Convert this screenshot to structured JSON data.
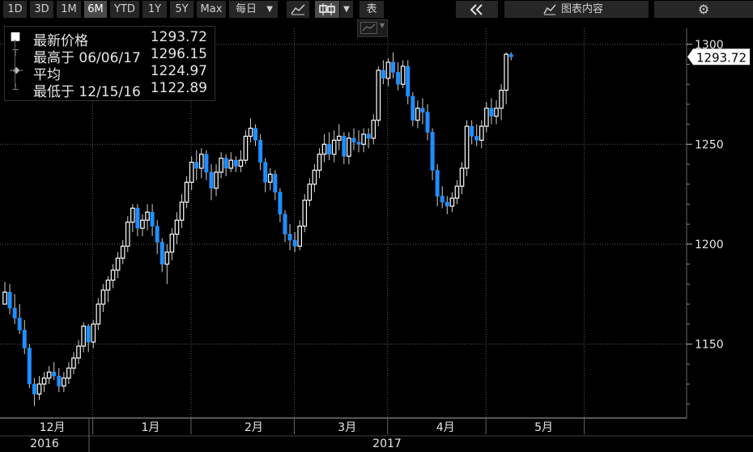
{
  "toolbar": {
    "periods": [
      {
        "label": "1D",
        "active": false
      },
      {
        "label": "3D",
        "active": false
      },
      {
        "label": "1M",
        "active": false
      },
      {
        "label": "6M",
        "active": true
      },
      {
        "label": "YTD",
        "active": false
      },
      {
        "label": "1Y",
        "active": false
      },
      {
        "label": "5Y",
        "active": false
      },
      {
        "label": "Max",
        "active": false
      }
    ],
    "frequency": "每日",
    "table_label": "表",
    "panel_label": "图表内容"
  },
  "legend": {
    "rows": [
      {
        "label": "最新价格",
        "value": "1293.72",
        "mark": "■"
      },
      {
        "label": "最高于 06/06/17",
        "value": "1296.15",
        "mark": "⊤"
      },
      {
        "label": "平均",
        "value": "1224.97",
        "mark": "-◆-"
      },
      {
        "label": "最低于 12/15/16",
        "value": "1122.89",
        "mark": "⊥"
      }
    ]
  },
  "chart_data": {
    "type": "candlestick",
    "ylim": [
      1113,
      1308
    ],
    "y_ticks": [
      1150,
      1200,
      1250,
      1300
    ],
    "grid": true,
    "last_price_label": "1293.72",
    "up_color": "#ffffff",
    "down_color": "#1f8fff",
    "month_labels": [
      {
        "label": "12月",
        "index": 8
      },
      {
        "label": "1月",
        "index": 28
      },
      {
        "label": "2月",
        "index": 49
      },
      {
        "label": "3月",
        "index": 68
      },
      {
        "label": "4月",
        "index": 88
      },
      {
        "label": "5月",
        "index": 108
      }
    ],
    "year_labels": [
      {
        "label": "2016",
        "index": 8
      },
      {
        "label": "2017",
        "index": 70
      }
    ],
    "candles": [
      [
        1170,
        1181,
        1170,
        1176
      ],
      [
        1176,
        1180,
        1165,
        1168
      ],
      [
        1168,
        1175,
        1160,
        1163
      ],
      [
        1163,
        1170,
        1155,
        1157
      ],
      [
        1157,
        1162,
        1145,
        1148
      ],
      [
        1148,
        1150,
        1128,
        1130
      ],
      [
        1130,
        1133,
        1119,
        1125
      ],
      [
        1125,
        1134,
        1122,
        1130
      ],
      [
        1130,
        1136,
        1126,
        1133
      ],
      [
        1133,
        1139,
        1130,
        1136
      ],
      [
        1136,
        1141,
        1132,
        1134
      ],
      [
        1134,
        1138,
        1126,
        1129
      ],
      [
        1129,
        1136,
        1126,
        1133
      ],
      [
        1133,
        1141,
        1130,
        1138
      ],
      [
        1138,
        1146,
        1135,
        1143
      ],
      [
        1143,
        1152,
        1140,
        1149
      ],
      [
        1149,
        1161,
        1146,
        1159
      ],
      [
        1159,
        1160,
        1146,
        1151
      ],
      [
        1151,
        1162,
        1148,
        1160
      ],
      [
        1160,
        1173,
        1157,
        1170
      ],
      [
        1170,
        1180,
        1166,
        1177
      ],
      [
        1177,
        1184,
        1171,
        1182
      ],
      [
        1182,
        1190,
        1178,
        1187
      ],
      [
        1187,
        1196,
        1183,
        1193
      ],
      [
        1193,
        1202,
        1190,
        1199
      ],
      [
        1199,
        1214,
        1196,
        1211
      ],
      [
        1211,
        1220,
        1206,
        1218
      ],
      [
        1218,
        1220,
        1204,
        1208
      ],
      [
        1208,
        1215,
        1204,
        1212
      ],
      [
        1212,
        1220,
        1207,
        1216
      ],
      [
        1216,
        1220,
        1204,
        1209
      ],
      [
        1209,
        1212,
        1195,
        1201
      ],
      [
        1201,
        1203,
        1186,
        1190
      ],
      [
        1190,
        1200,
        1180,
        1196
      ],
      [
        1196,
        1208,
        1192,
        1205
      ],
      [
        1205,
        1216,
        1200,
        1212
      ],
      [
        1212,
        1225,
        1208,
        1221
      ],
      [
        1221,
        1234,
        1218,
        1231
      ],
      [
        1231,
        1244,
        1227,
        1241
      ],
      [
        1241,
        1247,
        1232,
        1238
      ],
      [
        1238,
        1248,
        1233,
        1245
      ],
      [
        1245,
        1247,
        1232,
        1236
      ],
      [
        1236,
        1240,
        1222,
        1228
      ],
      [
        1228,
        1240,
        1224,
        1236
      ],
      [
        1236,
        1246,
        1233,
        1243
      ],
      [
        1243,
        1245,
        1234,
        1238
      ],
      [
        1238,
        1246,
        1236,
        1242
      ],
      [
        1242,
        1244,
        1236,
        1239
      ],
      [
        1239,
        1247,
        1236,
        1242
      ],
      [
        1242,
        1257,
        1240,
        1254
      ],
      [
        1254,
        1263,
        1251,
        1258
      ],
      [
        1258,
        1260,
        1249,
        1252
      ],
      [
        1252,
        1255,
        1237,
        1241
      ],
      [
        1241,
        1243,
        1226,
        1231
      ],
      [
        1231,
        1238,
        1227,
        1235
      ],
      [
        1235,
        1237,
        1222,
        1226
      ],
      [
        1226,
        1228,
        1211,
        1215
      ],
      [
        1215,
        1217,
        1201,
        1205
      ],
      [
        1205,
        1210,
        1197,
        1202
      ],
      [
        1202,
        1206,
        1196,
        1199
      ],
      [
        1199,
        1212,
        1197,
        1209
      ],
      [
        1209,
        1225,
        1206,
        1222
      ],
      [
        1222,
        1233,
        1219,
        1230
      ],
      [
        1230,
        1240,
        1226,
        1237
      ],
      [
        1237,
        1248,
        1233,
        1245
      ],
      [
        1245,
        1255,
        1241,
        1250
      ],
      [
        1250,
        1256,
        1242,
        1245
      ],
      [
        1245,
        1257,
        1241,
        1252
      ],
      [
        1252,
        1260,
        1247,
        1254
      ],
      [
        1254,
        1256,
        1240,
        1244
      ],
      [
        1244,
        1256,
        1240,
        1253
      ],
      [
        1253,
        1258,
        1247,
        1251
      ],
      [
        1251,
        1257,
        1246,
        1250
      ],
      [
        1250,
        1258,
        1246,
        1255
      ],
      [
        1255,
        1258,
        1248,
        1253
      ],
      [
        1253,
        1265,
        1250,
        1262
      ],
      [
        1262,
        1289,
        1259,
        1287
      ],
      [
        1287,
        1292,
        1280,
        1283
      ],
      [
        1283,
        1293,
        1279,
        1291
      ],
      [
        1291,
        1296,
        1283,
        1286
      ],
      [
        1286,
        1291,
        1277,
        1280
      ],
      [
        1280,
        1292,
        1278,
        1289
      ],
      [
        1289,
        1292,
        1270,
        1274
      ],
      [
        1274,
        1276,
        1259,
        1262
      ],
      [
        1262,
        1272,
        1258,
        1268
      ],
      [
        1268,
        1273,
        1260,
        1266
      ],
      [
        1266,
        1270,
        1252,
        1256
      ],
      [
        1256,
        1258,
        1232,
        1237
      ],
      [
        1237,
        1240,
        1219,
        1224
      ],
      [
        1224,
        1229,
        1218,
        1221
      ],
      [
        1221,
        1224,
        1215,
        1219
      ],
      [
        1219,
        1226,
        1216,
        1223
      ],
      [
        1223,
        1232,
        1220,
        1229
      ],
      [
        1229,
        1241,
        1225,
        1238
      ],
      [
        1238,
        1262,
        1234,
        1259
      ],
      [
        1259,
        1262,
        1250,
        1254
      ],
      [
        1254,
        1260,
        1249,
        1252
      ],
      [
        1252,
        1262,
        1248,
        1259
      ],
      [
        1259,
        1271,
        1256,
        1268
      ],
      [
        1268,
        1273,
        1260,
        1264
      ],
      [
        1264,
        1272,
        1260,
        1268
      ],
      [
        1268,
        1280,
        1262,
        1277
      ],
      [
        1277,
        1296,
        1270,
        1295
      ],
      [
        1295,
        1296,
        1292,
        1293.72
      ]
    ]
  }
}
